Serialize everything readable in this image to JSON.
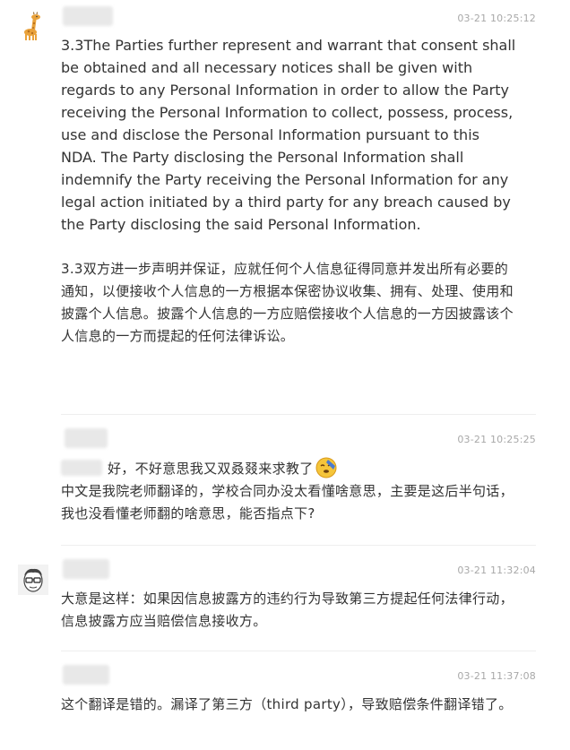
{
  "posts": [
    {
      "timestamp": "03-21 10:25:12",
      "paragraphs": [
        "3.3The Parties further represent and warrant that consent shall be obtained and all necessary notices shall be given with regards to any Personal Information in order to allow the Party receiving the Personal Information to collect, possess, process, use and disclose the Personal Information pursuant to this NDA. The Party disclosing the Personal Information shall indemnify the Party receiving the Personal Information for any legal action initiated by a third party for any breach caused by the Party disclosing the said Personal Information.",
        "3.3双方进一步声明并保证，应就任何个人信息征得同意并发出所有必要的通知，以便接收个人信息的一方根据本保密协议收集、拥有、处理、使用和披露个人信息。披露个人信息的一方应赔偿接收个人信息的一方因披露该个人信息的一方而提起的任何法律诉讼。"
      ],
      "avatar_icon": "giraffe-icon"
    },
    {
      "timestamp": "03-21 10:25:25",
      "line1": "好，不好意思我又双叒叕来求教了",
      "line2": "中文是我院老师翻译的，学校合同办没太看懂啥意思，主要是这后半句话，我也没看懂老师翻的啥意思，能否指点下?",
      "emoji_icon": "embarrassed-face-icon"
    },
    {
      "timestamp": "03-21 11:32:04",
      "text": "大意是这样：如果因信息披露方的违约行为导致第三方提起任何法律行动，信息披露方应当赔偿信息接收方。",
      "avatar_icon": "glasses-man-icon"
    },
    {
      "timestamp": "03-21 11:37:08",
      "text": "这个翻译是错的。漏译了第三方（third party），导致赔偿条件翻译错了。"
    }
  ]
}
